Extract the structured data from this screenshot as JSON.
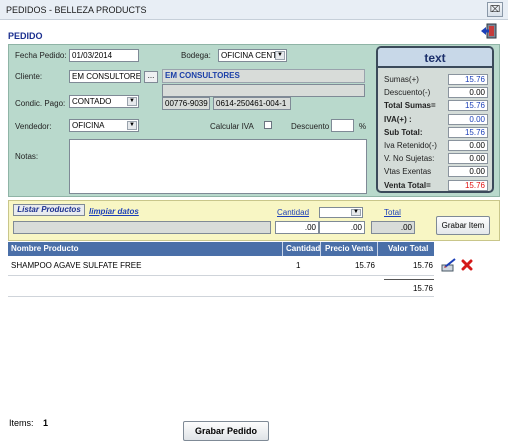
{
  "window": {
    "title": "PEDIDOS - BELLEZA PRODUCTS",
    "close_glyph": "⌧"
  },
  "header": {
    "label": "PEDIDO",
    "exit_icon": "exit-door-icon"
  },
  "form": {
    "fecha_label": "Fecha Pedido:",
    "fecha_value": "01/03/2014",
    "bodega_label": "Bodega:",
    "bodega_value": "OFICINA CENTI",
    "cliente_label": "Cliente:",
    "cliente_value": "EM CONSULTORES",
    "cliente_lookup": "...",
    "cliente_name": "EM CONSULTORES",
    "cliente_code": "00776-9039",
    "cliente_nit": "0614-250461-004-1",
    "condic_label": "Condic. Pago:",
    "condic_value": "CONTADO",
    "vendedor_label": "Vendedor:",
    "vendedor_value": "OFICINA",
    "calcular_label": "Calcular  IVA",
    "descuento_label": "Descuento",
    "descuento_unit": "%",
    "notas_label": "Notas:"
  },
  "totals": {
    "header": "text",
    "rows": [
      {
        "label": "Sumas(+)",
        "value": "15.76",
        "bold": false,
        "color": "#1b3fb8"
      },
      {
        "label": "Descuento(-)",
        "value": "0.00",
        "bold": false,
        "color": "#000000"
      },
      {
        "label": "Total Sumas=",
        "value": "15.76",
        "bold": true,
        "color": "#1b3fb8"
      },
      {
        "label": "IVA(+) :",
        "value": "0.00",
        "bold": true,
        "color": "#1b3fb8"
      },
      {
        "label": "Sub Total:",
        "value": "15.76",
        "bold": true,
        "color": "#1b3fb8"
      },
      {
        "label": "Iva Retenido(-)",
        "value": "0.00",
        "bold": false,
        "color": "#000000"
      },
      {
        "label": "V. No Sujetas:",
        "value": "0.00",
        "bold": false,
        "color": "#000000"
      },
      {
        "label": "Vtas Exentas",
        "value": "0.00",
        "bold": false,
        "color": "#000000"
      },
      {
        "label": "Venta Total=",
        "value": "15.76",
        "bold": true,
        "color": "#e01010"
      }
    ]
  },
  "entry": {
    "listar_label": "Listar Productos",
    "limpiar_label": "limpiar datos",
    "cantidad_label": "Cantidad",
    "total_label": "Total",
    "cantidad_value": ".00",
    "precio_value": ".00",
    "total_value": ".00",
    "grabar_item_label": "Grabar Item"
  },
  "grid": {
    "columns": [
      "Nombre Producto",
      "Cantidad",
      "Precio Venta",
      "Valor Total"
    ],
    "rows": [
      {
        "nombre": "SHAMPOO AGAVE SULFATE FREE",
        "cantidad": "1",
        "precio": "15.76",
        "valor": "15.76"
      }
    ],
    "footer_total": "15.76"
  },
  "footer": {
    "items_label": "Items:",
    "items_value": "1",
    "grabar_pedido_label": "Grabar Pedido"
  },
  "colors": {
    "accent": "#1b2f8f",
    "panel": "#b9d9cc",
    "entry_panel": "#f8f6c4",
    "grid_header": "#4a6fa8"
  }
}
